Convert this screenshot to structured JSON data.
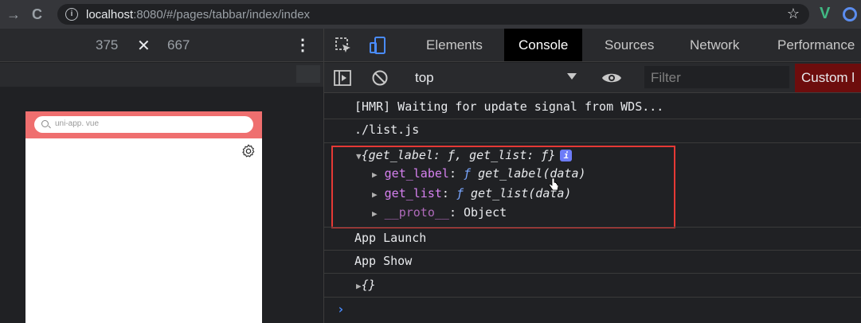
{
  "browser": {
    "url_host": "localhost",
    "url_path": ":8080/#/pages/tabbar/index/index",
    "nav_back": "→",
    "nav_reload": "C",
    "ext_label": "V"
  },
  "device_toolbar": {
    "width": "375",
    "times": "✕",
    "height": "667"
  },
  "phone": {
    "search_placeholder": "uni-app. vue",
    "header_color": "#ef6f6f"
  },
  "devtools": {
    "tabs": [
      "Elements",
      "Console",
      "Sources",
      "Network",
      "Performance"
    ],
    "active_tab": "Console",
    "context": "top",
    "filter_placeholder": "Filter",
    "custom_button": "Custom l"
  },
  "console": {
    "lines": {
      "hmr": "[HMR] Waiting for update signal from WDS...",
      "listjs": "./list.js",
      "obj_summary": "{get_label: ƒ, get_list: ƒ}",
      "prop1_key": "get_label",
      "prop1_val": "get_label(data)",
      "prop2_key": "get_list",
      "prop2_val": "get_list(data)",
      "proto_key": "__proto__",
      "proto_val": ": Object",
      "app_launch": "App Launch",
      "app_show": "App Show",
      "empty_obj": "{}",
      "f_symbol": "ƒ",
      "info_badge": "i",
      "colon": ":"
    },
    "prompt": "›"
  },
  "colors": {
    "highlight_box": "#e53935",
    "custom_button_bg": "#6d0d0d",
    "accent_blue": "#4a8cff"
  }
}
